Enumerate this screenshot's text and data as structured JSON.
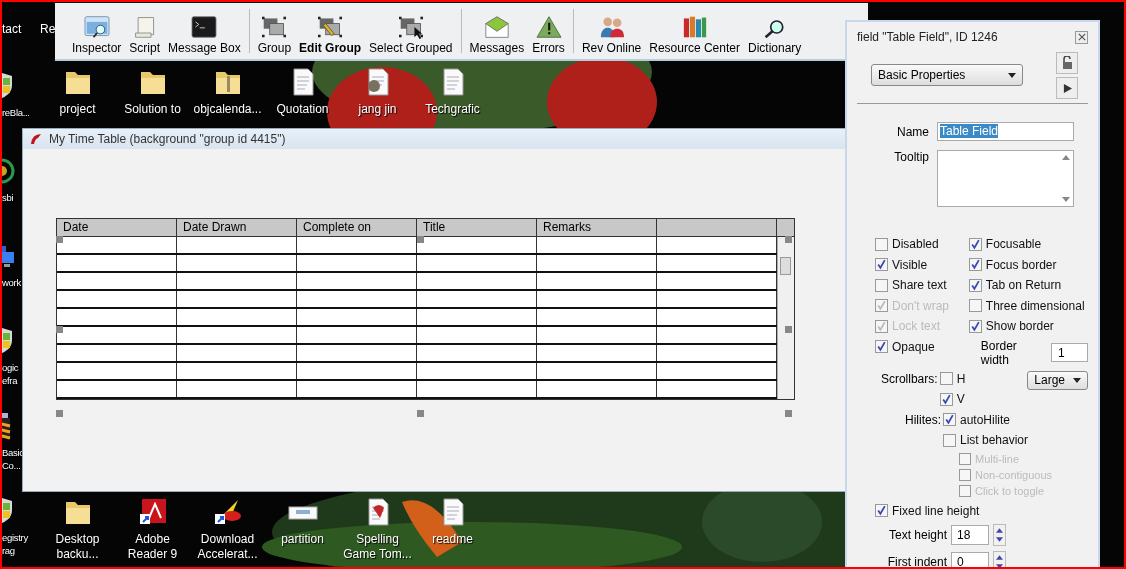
{
  "toolbar": {
    "items": [
      {
        "label": "Inspector",
        "kind": "inspector",
        "selected": false
      },
      {
        "label": "Script",
        "kind": "script",
        "selected": false
      },
      {
        "label": "Message Box",
        "kind": "terminal",
        "selected": false
      },
      {
        "label": "Group",
        "kind": "group",
        "selected": false
      },
      {
        "label": "Edit Group",
        "kind": "edit-group",
        "selected": true
      },
      {
        "label": "Select Grouped",
        "kind": "select-grouped",
        "selected": false
      },
      {
        "label": "Messages",
        "kind": "envelope",
        "selected": false
      },
      {
        "label": "Errors",
        "kind": "warning",
        "selected": false
      },
      {
        "label": "Rev Online",
        "kind": "people",
        "selected": false
      },
      {
        "label": "Resource Center",
        "kind": "books",
        "selected": false
      },
      {
        "label": "Dictionary",
        "kind": "magnifier",
        "selected": false
      }
    ]
  },
  "desktop": {
    "top_edge_labels": [
      "tact",
      "Re"
    ],
    "left_column": [
      {
        "label": "reBla...",
        "kind": "shield"
      },
      {
        "label": "sbi",
        "kind": "badge"
      },
      {
        "label": "work",
        "kind": "network"
      },
      {
        "label": "ogic\nefra",
        "kind": "shield"
      },
      {
        "label": "Basic\nCo...",
        "kind": "archive"
      },
      {
        "label": "egistry\nrag",
        "kind": "shield"
      }
    ],
    "top_row": [
      {
        "label": "project",
        "kind": "folder"
      },
      {
        "label": "Solution to",
        "kind": "folder"
      },
      {
        "label": "objcalenda...",
        "kind": "zip-folder"
      },
      {
        "label": "Quotation",
        "kind": "document"
      },
      {
        "label": "jang jin",
        "kind": "image-file"
      },
      {
        "label": "Techgrafic",
        "kind": "document"
      }
    ],
    "bottom_row": [
      {
        "label": "Desktop\nbacku...",
        "kind": "folder"
      },
      {
        "label": "Adobe\nReader 9",
        "kind": "pdf"
      },
      {
        "label": "Download\nAccelerat...",
        "kind": "accelerator"
      },
      {
        "label": "partition",
        "kind": "partition"
      },
      {
        "label": "Spelling\nGame Tom...",
        "kind": "stack-file"
      },
      {
        "label": "readme",
        "kind": "notepad"
      }
    ]
  },
  "window": {
    "title": "My Time Table (background \"group id 4415\")",
    "table": {
      "columns": [
        "Date",
        "Date Drawn",
        "Complete on",
        "Title",
        "Remarks"
      ]
    }
  },
  "inspector": {
    "title": "field \"Table Field\", ID 1246",
    "section": "Basic Properties",
    "name": {
      "label": "Name",
      "value": "Table Field"
    },
    "tooltip": {
      "label": "Tooltip"
    },
    "left_checkboxes": [
      {
        "label": "Disabled",
        "checked": false,
        "disabled": false
      },
      {
        "label": "Visible",
        "checked": true,
        "disabled": false
      },
      {
        "label": "Share text",
        "checked": false,
        "disabled": false
      },
      {
        "label": "Don't wrap",
        "checked": true,
        "disabled": true
      },
      {
        "label": "Lock text",
        "checked": true,
        "disabled": true
      },
      {
        "label": "Opaque",
        "checked": true,
        "disabled": false
      }
    ],
    "right_checkboxes": [
      {
        "label": "Focusable",
        "checked": true,
        "disabled": false
      },
      {
        "label": "Focus border",
        "checked": true,
        "disabled": false
      },
      {
        "label": "Tab on Return",
        "checked": true,
        "disabled": false
      },
      {
        "label": "Three dimensional",
        "checked": false,
        "disabled": false
      },
      {
        "label": "Show border",
        "checked": true,
        "disabled": false
      }
    ],
    "border_width": {
      "label": "Border width",
      "value": "1"
    },
    "scrollbars": {
      "label": "Scrollbars:",
      "h": {
        "label": "H",
        "checked": false
      },
      "v": {
        "label": "V",
        "checked": true
      },
      "size": "Large"
    },
    "hilites": {
      "label": "Hilites:",
      "options": [
        {
          "label": "autoHilite",
          "checked": true,
          "disabled": false
        },
        {
          "label": "List behavior",
          "checked": false,
          "disabled": false
        }
      ],
      "sub_options": [
        {
          "label": "Multi-line",
          "checked": false,
          "disabled": true
        },
        {
          "label": "Non-contiguous",
          "checked": false,
          "disabled": true
        },
        {
          "label": "Click to toggle",
          "checked": false,
          "disabled": true
        }
      ]
    },
    "fixed_line_height": {
      "label": "Fixed line height",
      "checked": true
    },
    "text_height": {
      "label": "Text height",
      "value": "18"
    },
    "first_indent": {
      "label": "First indent",
      "value": "0"
    }
  }
}
